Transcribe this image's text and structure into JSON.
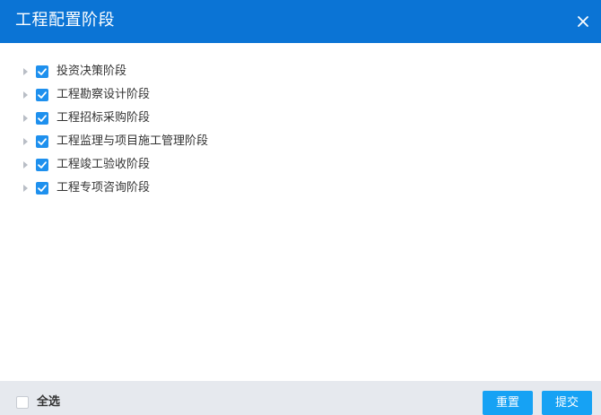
{
  "dialog": {
    "title": "工程配置阶段",
    "close_icon": "close-icon"
  },
  "tree": {
    "items": [
      {
        "label": "投资决策阶段",
        "checked": true
      },
      {
        "label": "工程勘察设计阶段",
        "checked": true
      },
      {
        "label": "工程招标采购阶段",
        "checked": true
      },
      {
        "label": "工程监理与项目施工管理阶段",
        "checked": true
      },
      {
        "label": "工程竣工验收阶段",
        "checked": true
      },
      {
        "label": "工程专项咨询阶段",
        "checked": true
      }
    ]
  },
  "footer": {
    "select_all_label": "全选",
    "select_all_checked": false,
    "reset_label": "重置",
    "submit_label": "提交"
  },
  "colors": {
    "header": "#0b74d5",
    "checkbox": "#1e90ee",
    "button": "#16a2f4",
    "footer": "#e6e9ee"
  }
}
